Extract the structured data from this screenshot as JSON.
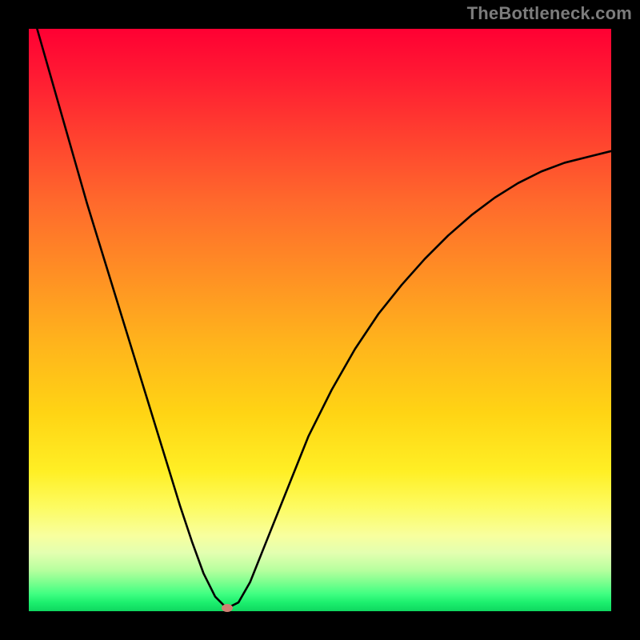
{
  "watermark": "TheBottleneck.com",
  "colors": {
    "frame": "#000000",
    "gradient_top": "#ff0033",
    "gradient_bottom": "#0fd75f",
    "curve": "#000000",
    "dot": "#cf8072",
    "watermark": "#7c7c7c"
  },
  "chart_data": {
    "type": "line",
    "title": "",
    "xlabel": "",
    "ylabel": "",
    "xlim": [
      0,
      100
    ],
    "ylim": [
      0,
      100
    ],
    "annotations": [
      "TheBottleneck.com"
    ],
    "series": [
      {
        "name": "bottleneck-curve",
        "x": [
          0,
          2,
          4,
          6,
          8,
          10,
          12,
          14,
          16,
          18,
          20,
          22,
          24,
          26,
          28,
          30,
          32,
          34,
          36,
          38,
          40,
          44,
          48,
          52,
          56,
          60,
          64,
          68,
          72,
          76,
          80,
          84,
          88,
          92,
          96,
          100
        ],
        "y": [
          105,
          98,
          91,
          84,
          77,
          70,
          63.5,
          57,
          50.5,
          44,
          37.5,
          31,
          24.5,
          18,
          12,
          6.5,
          2.5,
          0.5,
          1.5,
          5,
          10,
          20,
          30,
          38,
          45,
          51,
          56,
          60.5,
          64.5,
          68,
          71,
          73.5,
          75.5,
          77,
          78,
          79
        ]
      }
    ],
    "marker": {
      "x": 34,
      "y": 0.5
    }
  }
}
